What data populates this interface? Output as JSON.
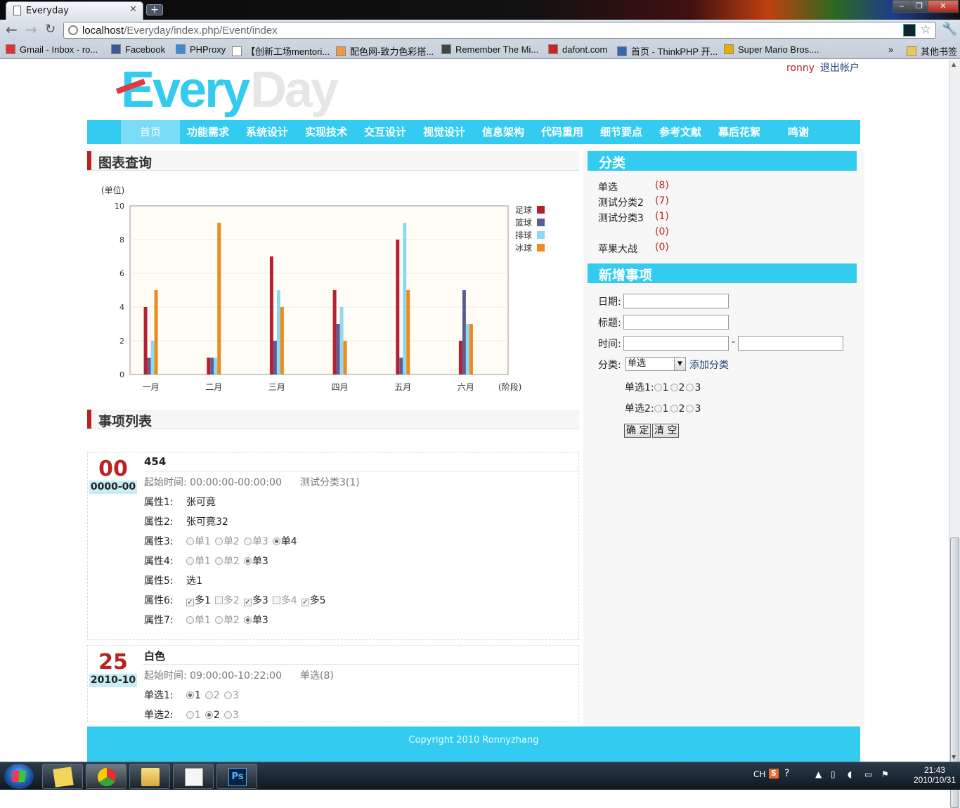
{
  "browser": {
    "tab_title": "Everyday",
    "new_tab": "+",
    "window_controls": {
      "minimize": "‒",
      "restore": "❐",
      "close": "✕"
    },
    "url_host": "localhost",
    "url_path": "/Everyday/index.php/Event/index",
    "bookmarks": [
      {
        "label": "Gmail - Inbox - ro...",
        "color": "#d33"
      },
      {
        "label": "Facebook",
        "color": "#3b5998"
      },
      {
        "label": "PHProxy",
        "color": "#3a8ad8"
      },
      {
        "label": "【创新工场mentori...",
        "color": "#ffffff"
      },
      {
        "label": "配色网-致力色彩搭...",
        "color": "#e94"
      },
      {
        "label": "Remember The Mi...",
        "color": "#444"
      },
      {
        "label": "dafont.com",
        "color": "#c22"
      },
      {
        "label": "首页 - ThinkPHP 开...",
        "color": "#3468b0"
      },
      {
        "label": "Super Mario Bros....",
        "color": "#e6b000"
      }
    ],
    "bookmarks_more": "»",
    "other_bookmarks": "其他书签"
  },
  "header": {
    "logo_main": "Every",
    "logo_ghost": "Day",
    "username": "ronny",
    "logout": "退出帐户"
  },
  "nav": {
    "items": [
      "首页",
      "功能需求",
      "系统设计",
      "实现技术",
      "交互设计",
      "视觉设计",
      "信息架构",
      "代码重用",
      "细节要点",
      "参考文献",
      "幕后花絮",
      "鸣谢"
    ],
    "active_index": 0
  },
  "chart_section": {
    "title": "图表查询"
  },
  "chart_data": {
    "type": "bar",
    "categories": [
      "一月",
      "二月",
      "三月",
      "四月",
      "五月",
      "六月"
    ],
    "series": [
      {
        "name": "足球",
        "color": "#b5212e",
        "values": [
          4,
          1,
          7,
          5,
          8,
          2
        ]
      },
      {
        "name": "篮球",
        "color": "#5b5e93",
        "values": [
          1,
          1,
          2,
          3,
          1,
          5
        ]
      },
      {
        "name": "排球",
        "color": "#8fd8ee",
        "values": [
          2,
          1,
          5,
          4,
          9,
          3
        ]
      },
      {
        "name": "冰球",
        "color": "#ee8a1e",
        "values": [
          5,
          9,
          4,
          2,
          5,
          3
        ]
      }
    ],
    "ylabel": "(单位)",
    "xlabel": "(阶段)",
    "ylim": [
      0,
      10
    ],
    "yticks": [
      0,
      2,
      4,
      6,
      8,
      10
    ],
    "grid": true,
    "legend": "right"
  },
  "events_section": {
    "title": "事项列表"
  },
  "events": [
    {
      "day": "00",
      "date": "0000-00",
      "title": "454",
      "time_label": "起始时间: 00:00:00-00:00:00",
      "category": "测试分类3(1)",
      "attrs": [
        {
          "label": "属性1:",
          "value": "张可竟"
        },
        {
          "label": "属性2:",
          "value": "张可竟32"
        },
        {
          "label": "属性3:",
          "radios": [
            "单1",
            "单2",
            "单3",
            "单4"
          ],
          "selected": 3
        },
        {
          "label": "属性4:",
          "radios": [
            "单1",
            "单2",
            "单3"
          ],
          "selected": 2
        },
        {
          "label": "属性5:",
          "value": "选1"
        },
        {
          "label": "属性6:",
          "checks": [
            "多1",
            "多2",
            "多3",
            "多4",
            "多5"
          ],
          "checked": [
            0,
            2,
            4
          ]
        },
        {
          "label": "属性7:",
          "radios": [
            "单1",
            "单2",
            "单3"
          ],
          "selected": 2
        }
      ]
    },
    {
      "day": "25",
      "date": "2010-10",
      "title": "白色",
      "time_label": "起始时间: 09:00:00-10:22:00",
      "category": "单选(8)",
      "attrs": [
        {
          "label": "单选1:",
          "radios": [
            "1",
            "2",
            "3"
          ],
          "selected": 0
        },
        {
          "label": "单选2:",
          "radios": [
            "1",
            "2",
            "3"
          ],
          "selected": 1
        }
      ]
    }
  ],
  "sidebar": {
    "categories_title": "分类",
    "categories": [
      {
        "name": "单选",
        "count": "(8)"
      },
      {
        "name": "测试分类2",
        "count": "(7)"
      },
      {
        "name": "测试分类3",
        "count": "(1)"
      },
      {
        "name": "",
        "count": "(0)"
      },
      {
        "name": "苹果大战",
        "count": "(0)"
      }
    ],
    "new_title": "新增事项",
    "form": {
      "date_label": "日期:",
      "title_label": "标题:",
      "time_label": "时间:",
      "time_sep": "-",
      "category_label": "分类:",
      "category_value": "单选",
      "add_category": "添加分类",
      "radio1_label": "单选1:",
      "radio2_label": "单选2:",
      "radio_opts": [
        "1",
        "2",
        "3"
      ],
      "confirm": "确 定",
      "clear": "清 空"
    }
  },
  "footer": {
    "text": "Copyright 2010 Ronnyzhang"
  },
  "taskbar": {
    "ime": "CH",
    "time": "21:43",
    "date": "2010/10/31",
    "ps_label": "Ps"
  }
}
